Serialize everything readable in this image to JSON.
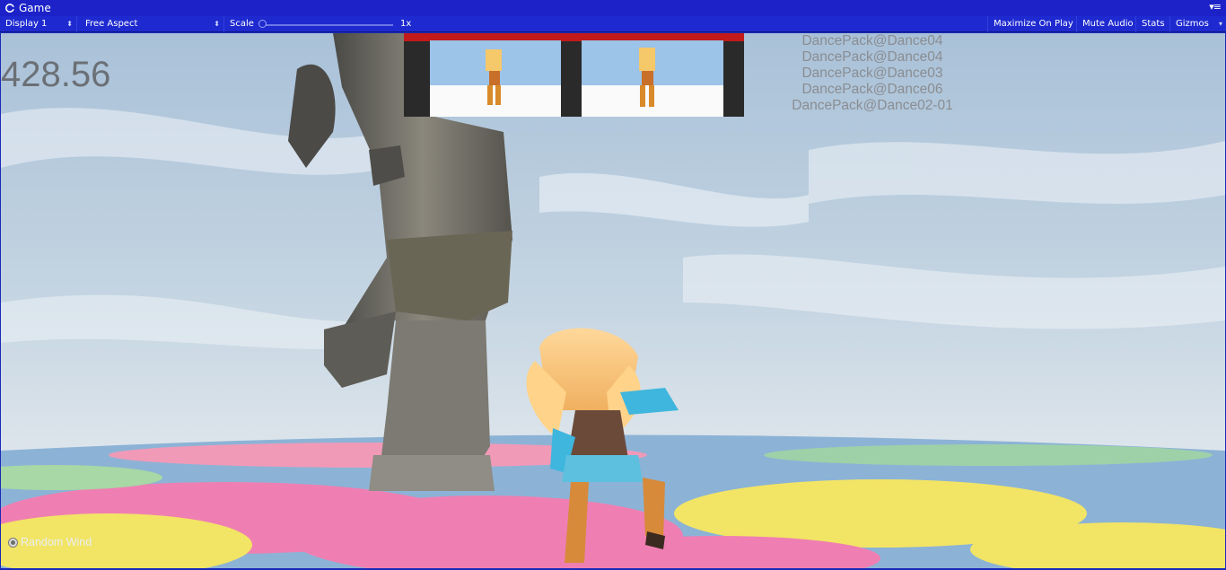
{
  "window": {
    "tab_title": "Game",
    "tab_icon": "unity-logo-icon",
    "menu_icon": "window-menu-icon"
  },
  "toolbar": {
    "display": "Display 1",
    "aspect": "Free Aspect",
    "scale_label": "Scale",
    "scale_value": "1x",
    "maximize": "Maximize On Play",
    "mute": "Mute Audio",
    "stats": "Stats",
    "gizmos": "Gizmos"
  },
  "game": {
    "fps": "428.56",
    "animations": [
      "DancePack@Dance04",
      "DancePack@Dance04",
      "DancePack@Dance03",
      "DancePack@Dance06",
      "DancePack@Dance02-01"
    ],
    "random_wind_label": "Random Wind"
  },
  "colors": {
    "editor_chrome": "#1e2ad0",
    "sky": "#b8ccdc",
    "floor_pink": "#ef7fb2",
    "floor_yellow": "#f2e465",
    "floor_blue": "#8cb3d6"
  }
}
